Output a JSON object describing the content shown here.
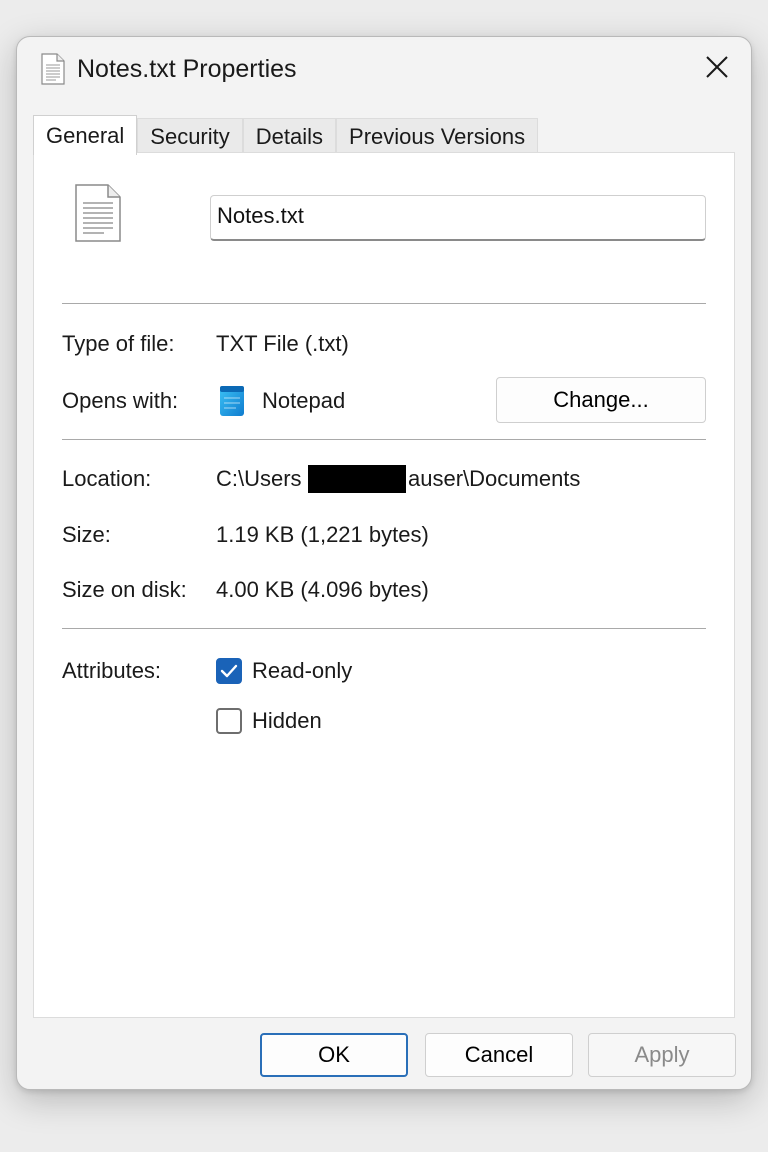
{
  "window": {
    "title": "Notes.txt Properties",
    "title_icon": "text-file-icon",
    "close_icon": "close-icon"
  },
  "tabs": [
    {
      "label": "General",
      "active": true
    },
    {
      "label": "Security",
      "active": false
    },
    {
      "label": "Details",
      "active": false
    },
    {
      "label": "Previous Versions",
      "active": false
    }
  ],
  "general": {
    "file_name": "Notes.txt",
    "type_label": "Type of file:",
    "type_value": "TXT File (.txt)",
    "opens_label": "Opens with:",
    "opens_app": "Notepad",
    "change_label": "Change...",
    "location_label": "Location:",
    "location_prefix": "C:\\Users",
    "location_suffix": "auser\\Documents",
    "size_label": "Size:",
    "size_value": "1.19 KB (1,221 bytes)",
    "size_on_disk_label": "Size on disk:",
    "size_on_disk_value": "4.00 KB (4.096 bytes)",
    "attributes_label": "Attributes:",
    "attributes": [
      {
        "label": "Read-only",
        "checked": true
      },
      {
        "label": "Hidden",
        "checked": false
      }
    ]
  },
  "buttons": {
    "ok": "OK",
    "cancel": "Cancel",
    "apply": "Apply"
  },
  "colors": {
    "accent": "#1a63b8",
    "ok_border": "#2a6fb8",
    "notepad_blue": "#1ea0e6"
  }
}
